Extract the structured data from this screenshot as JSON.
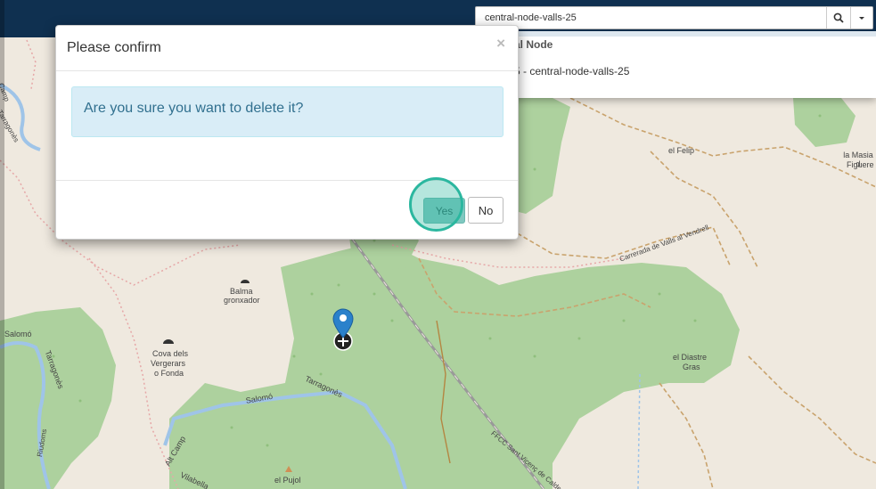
{
  "search": {
    "value": "central-node-valls-25",
    "placeholder": ""
  },
  "results": {
    "heading": "al Node",
    "item": "5 - central-node-valls-25"
  },
  "dialog": {
    "title": "Please confirm",
    "close_symbol": "×",
    "message": "Are you sure you want to delete it?",
    "yes_label": "Yes",
    "no_label": "No"
  },
  "map": {
    "labels": {
      "felip": "el Felip",
      "masia_1": "la Masia d",
      "masia_2": "Figuere",
      "carrerada": "Carrerada de Valls al Vendrell",
      "balma_1": "Balma",
      "balma_2": "gronxador",
      "cova_1": "Cova dels",
      "cova_2": "Vergerars",
      "cova_3": "o Fonda",
      "salomo_1": "Salomó",
      "salomo_2": "Salomó",
      "tarragones_1": "Tarragonès",
      "tarragones_2": "Tarragonès",
      "diastre_1": "el Diastre",
      "diastre_2": "Gras",
      "pujol": "el Pujol",
      "vilabella": "Vilabella",
      "camp": "Alt Camp",
      "rail": "FFCC Sant Vicenç de Calders",
      "camp_top": "Camp",
      "tarrag_top": "Tarragonès",
      "riudoms": "Riudoms"
    }
  },
  "colors": {
    "topbar": "#0f3050",
    "forest": "#add19e",
    "alert_bg": "#d9edf7",
    "alert_text": "#31708f",
    "yes_btn": "#7fc8c0",
    "click_ring": "#2bb79f",
    "marker": "#2a81cb"
  },
  "icons": {
    "search": "search-icon",
    "caret": "caret-down-icon",
    "marker": "map-marker-icon",
    "close": "close-icon"
  }
}
